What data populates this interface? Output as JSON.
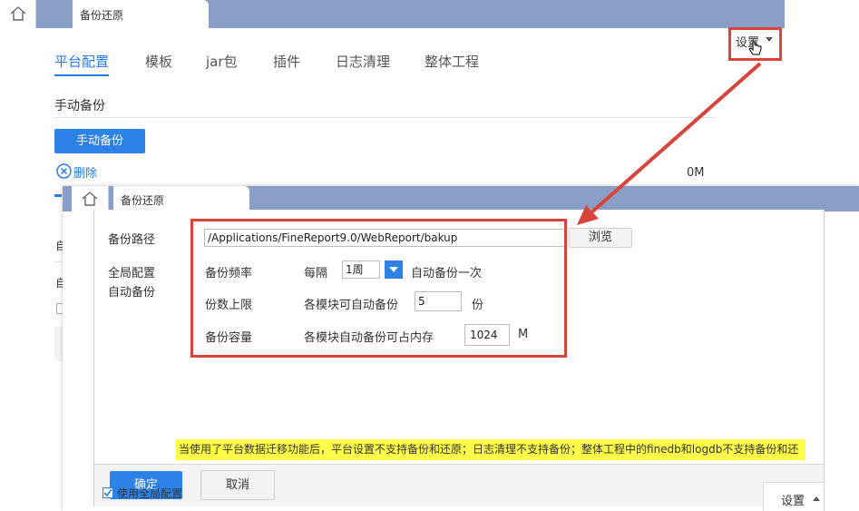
{
  "back_window": {
    "home_icon": "home-icon",
    "tab_label": "备份还原",
    "nav_tabs": [
      "平台配置",
      "模板",
      "jar包",
      "插件",
      "日志清理",
      "整体工程"
    ],
    "active_tab": "平台配置",
    "section_title": "手动备份",
    "manual_backup_button": "手动备份",
    "delete_label": "删除",
    "size_label": "0M",
    "settings_label": "设置",
    "side_chars": [
      "自",
      "自"
    ]
  },
  "front_window": {
    "home_icon": "home-icon",
    "tab_label": "备份还原",
    "backup_path_label": "备份路径",
    "backup_path_value": "/Applications/FineReport9.0/WebReport/bakup",
    "browse_button": "浏览",
    "global_config_label_1": "全局配置",
    "global_config_label_2": "自动备份",
    "frequency_label": "备份频率",
    "frequency_prefix": "每隔",
    "frequency_value": "1周",
    "frequency_suffix": "自动备份一次",
    "count_label": "份数上限",
    "count_prefix": "各模块可自动备份",
    "count_value": "5",
    "count_suffix": "份",
    "capacity_label": "备份容量",
    "capacity_prefix": "各模块自动备份可占内存",
    "capacity_value": "1024",
    "capacity_suffix": "M",
    "notice": "当使用了平台数据迁移功能后，平台设置不支持备份和还原；日志清理不支持备份；整体工程中的finedb和logdb不支持备份和还原",
    "confirm_button": "确定",
    "cancel_button": "取消",
    "use_global_config_label": "使用全局配置",
    "settings_label": "设置"
  },
  "colors": {
    "accent": "#2c82e6",
    "tabbar": "#8a9fc7",
    "highlight_box": "#d9443a",
    "notice_bg": "#ffff4a"
  }
}
